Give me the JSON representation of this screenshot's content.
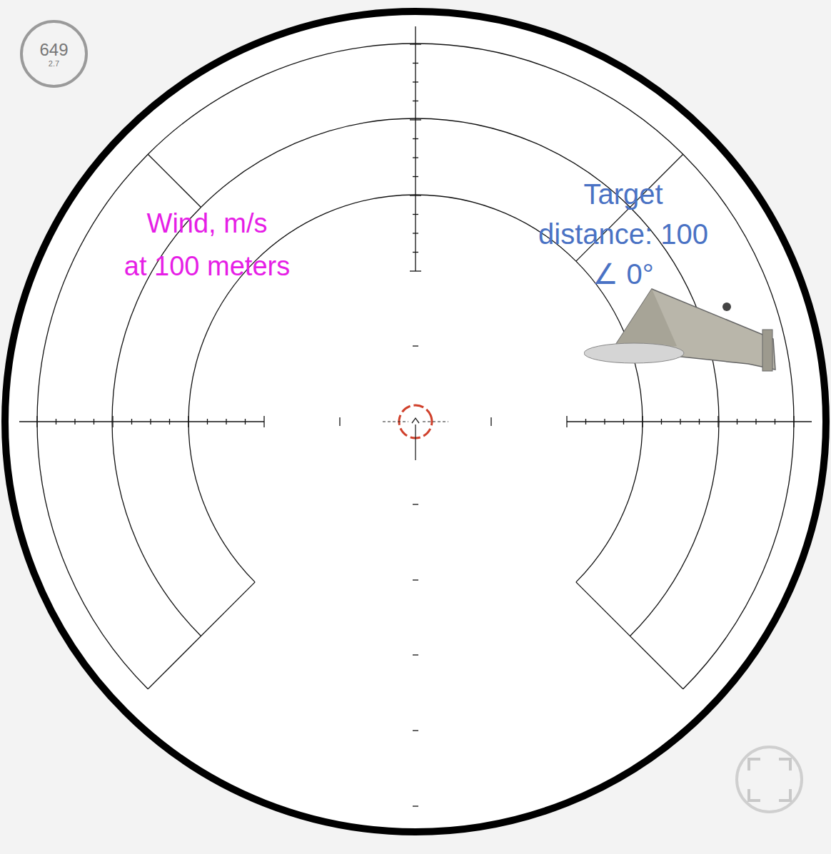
{
  "badge": {
    "value": "649",
    "sub": "2.7"
  },
  "wind_label": {
    "lines": [
      "Wind, m/s",
      "at 100 meters"
    ]
  },
  "target_label": {
    "lines": [
      "Target",
      "distance: 100",
      "∠ 0°"
    ]
  }
}
